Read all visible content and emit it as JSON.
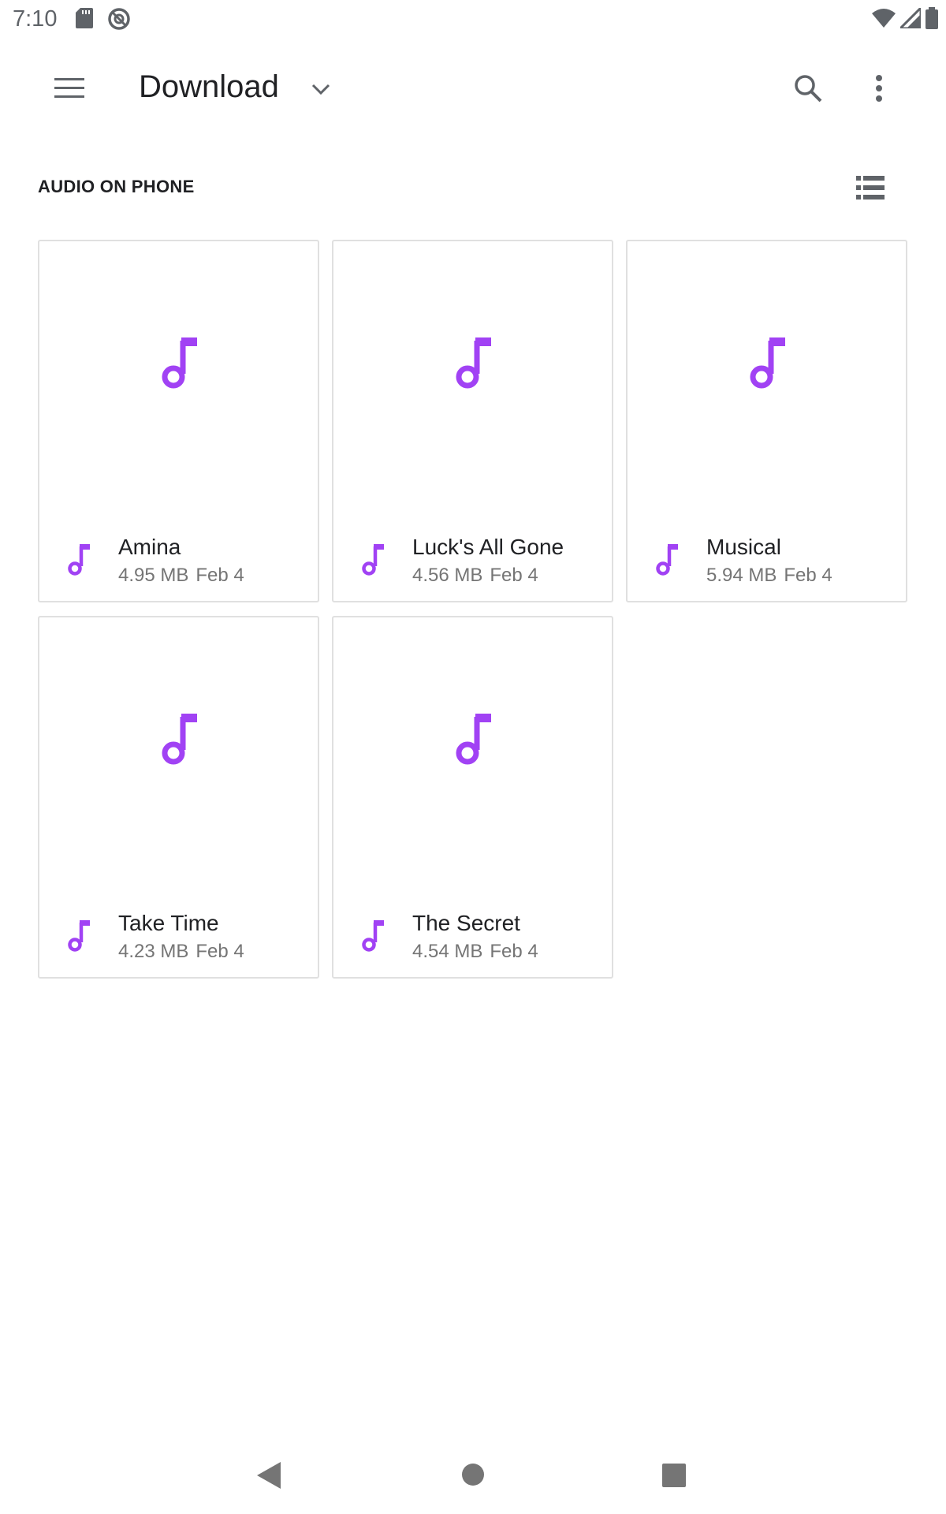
{
  "status_bar": {
    "time": "7:10",
    "icons": [
      "sd-card-icon",
      "sync-icon",
      "wifi-icon",
      "signal-icon",
      "battery-icon"
    ]
  },
  "toolbar": {
    "title": "Download",
    "icons": [
      "menu-icon",
      "chevron-down-icon",
      "search-icon",
      "more-vert-icon"
    ]
  },
  "section": {
    "title": "AUDIO ON PHONE",
    "view_toggle_icon": "list-view-icon"
  },
  "files": [
    {
      "name": "Amina",
      "size": "4.95 MB",
      "date": "Feb 4"
    },
    {
      "name": "Luck's All Gone",
      "size": "4.56 MB",
      "date": "Feb 4"
    },
    {
      "name": "Musical",
      "size": "5.94 MB",
      "date": "Feb 4"
    },
    {
      "name": "Take Time",
      "size": "4.23 MB",
      "date": "Feb 4"
    },
    {
      "name": "The Secret",
      "size": "4.54 MB",
      "date": "Feb 4"
    }
  ],
  "nav_bar": {
    "icons": [
      "back-icon",
      "home-icon",
      "recents-icon"
    ]
  },
  "colors": {
    "accent": "#a142f4",
    "card_border": "#e0e0e0",
    "icon_gray": "#5f6368"
  }
}
